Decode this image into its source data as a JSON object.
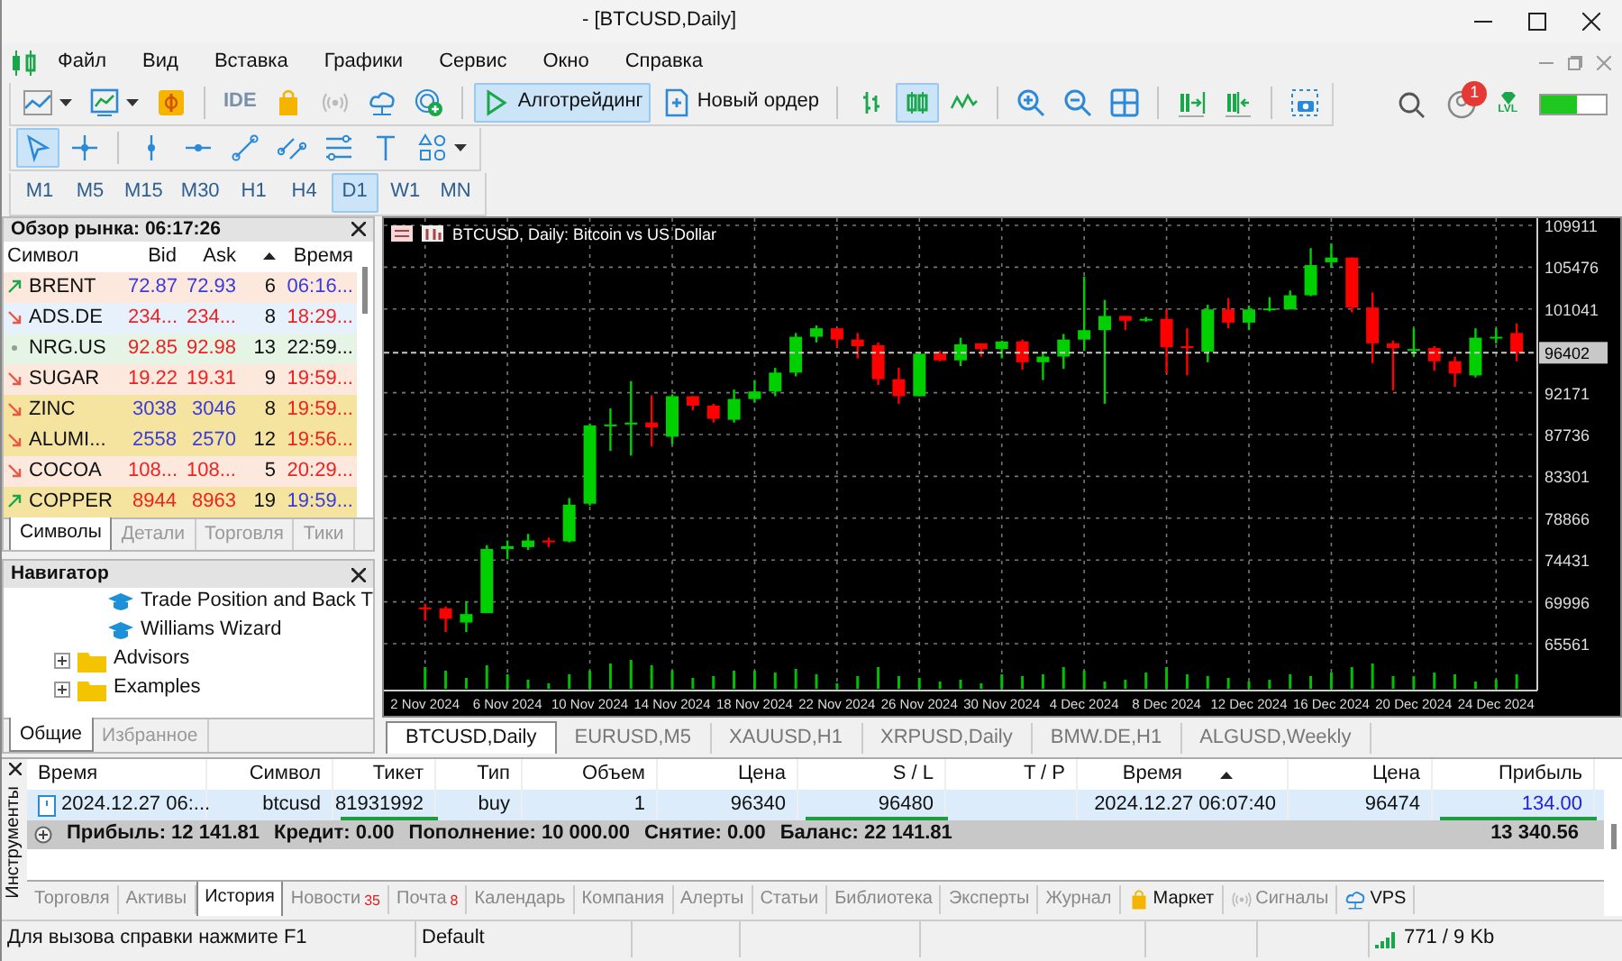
{
  "window": {
    "title": "- [BTCUSD,Daily]"
  },
  "menu": [
    "Файл",
    "Вид",
    "Вставка",
    "Графики",
    "Сервис",
    "Окно",
    "Справка"
  ],
  "toolbar": {
    "ide": "IDE",
    "algo_trading": {
      "label": "Алготрейдинг",
      "selected": true
    },
    "new_order": {
      "label": "Новый ордер",
      "selected": false
    },
    "chart_types": [
      {
        "selected": false
      },
      {
        "selected": true
      },
      {
        "selected": false
      }
    ],
    "notification_count": "1",
    "level_badge": "LVL",
    "meter": {
      "level": 0.55
    }
  },
  "drawing_tools": [
    {
      "selected": true
    },
    {
      "selected": false
    },
    {
      "selected": false
    },
    {
      "selected": false
    },
    {
      "selected": false
    },
    {
      "selected": false
    },
    {
      "selected": false
    },
    {
      "selected": false
    },
    {
      "selected": false
    }
  ],
  "timeframes": [
    {
      "label": "M1",
      "selected": false
    },
    {
      "label": "M5",
      "selected": false
    },
    {
      "label": "M15",
      "selected": false
    },
    {
      "label": "M30",
      "selected": false
    },
    {
      "label": "H1",
      "selected": false
    },
    {
      "label": "H4",
      "selected": false
    },
    {
      "label": "D1",
      "selected": true
    },
    {
      "label": "W1",
      "selected": false
    },
    {
      "label": "MN",
      "selected": false
    }
  ],
  "market_watch": {
    "title": "Обзор рынка: 06:17:26",
    "columns": [
      {
        "label": "Символ",
        "sorted": false
      },
      {
        "label": "Bid",
        "sorted": false
      },
      {
        "label": "Ask",
        "sorted": false
      },
      {
        "sorted": true
      },
      {
        "label": "Время",
        "sorted": false
      }
    ],
    "rows": [
      {
        "kind": "up",
        "symbol": "BRENT",
        "bid": {
          "text": "72.87",
          "color": "#3b3bdc"
        },
        "ask": {
          "text": "72.93",
          "color": "#3b3bdc"
        },
        "spread": "6",
        "time": {
          "text": "06:16...",
          "color": "#3b3bdc"
        },
        "color": "#fce8dc"
      },
      {
        "kind": "down",
        "symbol": "ADS.DE",
        "bid": {
          "text": "234...",
          "color": "#ee2222"
        },
        "ask": {
          "text": "234...",
          "color": "#ee2222"
        },
        "spread": "8",
        "time": {
          "text": "18:29...",
          "color": "#ee2222"
        },
        "color": "#e6f1fb"
      },
      {
        "kind": "flat",
        "symbol": "NRG.US",
        "bid": {
          "text": "92.85",
          "color": "#ee2222"
        },
        "ask": {
          "text": "92.98",
          "color": "#ee2222"
        },
        "spread": "13",
        "time": {
          "text": "22:59...",
          "color": "#111111"
        },
        "color": "#e6f4e6"
      },
      {
        "kind": "down",
        "symbol": "SUGAR",
        "bid": {
          "text": "19.22",
          "color": "#ee2222"
        },
        "ask": {
          "text": "19.31",
          "color": "#ee2222"
        },
        "spread": "9",
        "time": {
          "text": "19:59...",
          "color": "#ee2222"
        },
        "color": "#fce8dc"
      },
      {
        "kind": "down",
        "symbol": "ZINC",
        "bid": {
          "text": "3038",
          "color": "#3b3bdc"
        },
        "ask": {
          "text": "3046",
          "color": "#3b3bdc"
        },
        "spread": "8",
        "time": {
          "text": "19:59...",
          "color": "#ee2222"
        },
        "color": "#f5e4a0"
      },
      {
        "kind": "down",
        "symbol": "ALUMI...",
        "bid": {
          "text": "2558",
          "color": "#3b3bdc"
        },
        "ask": {
          "text": "2570",
          "color": "#3b3bdc"
        },
        "spread": "12",
        "time": {
          "text": "19:56...",
          "color": "#ee2222"
        },
        "color": "#f5e4a0"
      },
      {
        "kind": "down",
        "symbol": "COCOA",
        "bid": {
          "text": "108...",
          "color": "#ee2222"
        },
        "ask": {
          "text": "108...",
          "color": "#ee2222"
        },
        "spread": "5",
        "time": {
          "text": "20:29...",
          "color": "#ee2222"
        },
        "color": "#fce8dc"
      },
      {
        "kind": "up",
        "symbol": "COPPER",
        "bid": {
          "text": "8944",
          "color": "#ee2222"
        },
        "ask": {
          "text": "8963",
          "color": "#ee2222"
        },
        "spread": "19",
        "time": {
          "text": "19:59...",
          "color": "#3b3bdc"
        },
        "color": "#f5e4a0"
      }
    ],
    "tabs": [
      {
        "label": "Символы",
        "selected": true
      },
      {
        "label": "Детали",
        "selected": false
      },
      {
        "label": "Торговля",
        "selected": false
      },
      {
        "label": "Тики",
        "selected": false
      }
    ]
  },
  "navigator": {
    "title": "Навигатор",
    "tree": [
      {
        "children": [
          {
            "label": "Trade Position and Back T",
            "kind": "wizard"
          },
          {
            "label": "Williams Wizard",
            "kind": "wizard"
          }
        ]
      },
      {
        "label": "Advisors",
        "kind": "folder",
        "expanded": false
      },
      {
        "label": "Examples",
        "kind": "folder",
        "expanded": false
      }
    ],
    "tabs": [
      {
        "label": "Общие",
        "selected": true
      },
      {
        "label": "Избранное",
        "selected": false
      }
    ]
  },
  "chart": {
    "title": "BTCUSD, Daily:  Bitcoin vs US Dollar",
    "chart_data": {
      "type": "candlestick",
      "x": [
        "2024-11-02",
        "2024-11-03",
        "2024-11-04",
        "2024-11-05",
        "2024-11-06",
        "2024-11-07",
        "2024-11-08",
        "2024-11-09",
        "2024-11-10",
        "2024-11-11",
        "2024-11-12",
        "2024-11-13",
        "2024-11-14",
        "2024-11-15",
        "2024-11-16",
        "2024-11-17",
        "2024-11-18",
        "2024-11-19",
        "2024-11-20",
        "2024-11-21",
        "2024-11-22",
        "2024-11-23",
        "2024-11-24",
        "2024-11-25",
        "2024-11-26",
        "2024-11-27",
        "2024-11-28",
        "2024-11-29",
        "2024-11-30",
        "2024-12-01",
        "2024-12-02",
        "2024-12-03",
        "2024-12-04",
        "2024-12-05",
        "2024-12-06",
        "2024-12-07",
        "2024-12-08",
        "2024-12-09",
        "2024-12-10",
        "2024-12-11",
        "2024-12-12",
        "2024-12-13",
        "2024-12-14",
        "2024-12-15",
        "2024-12-16",
        "2024-12-17",
        "2024-12-18",
        "2024-12-19",
        "2024-12-20",
        "2024-12-21",
        "2024-12-22",
        "2024-12-23",
        "2024-12-24",
        "2024-12-25"
      ],
      "ohlc": [
        [
          69400,
          69800,
          68000,
          69300
        ],
        [
          69300,
          69500,
          66800,
          68200
        ],
        [
          67800,
          70000,
          66800,
          68700
        ],
        [
          68800,
          76000,
          68800,
          75600
        ],
        [
          75600,
          76500,
          74500,
          75900
        ],
        [
          75800,
          77200,
          75500,
          76500
        ],
        [
          76500,
          76800,
          75800,
          76300
        ],
        [
          76400,
          81000,
          76300,
          80300
        ],
        [
          80400,
          88900,
          80200,
          88700
        ],
        [
          88700,
          90500,
          86000,
          88800
        ],
        [
          88800,
          93400,
          85500,
          89000
        ],
        [
          89000,
          91900,
          86500,
          88500
        ],
        [
          87500,
          92000,
          86700,
          91800
        ],
        [
          91800,
          91800,
          90300,
          90800
        ],
        [
          90800,
          91000,
          89000,
          89400
        ],
        [
          89300,
          92500,
          89000,
          91500
        ],
        [
          91500,
          93500,
          91100,
          92300
        ],
        [
          92300,
          94800,
          91800,
          94300
        ],
        [
          94300,
          98500,
          93900,
          98100
        ],
        [
          98100,
          99300,
          97500,
          99000
        ],
        [
          99000,
          99000,
          97000,
          97800
        ],
        [
          97800,
          98500,
          95800,
          97100
        ],
        [
          97200,
          97500,
          93000,
          93600
        ],
        [
          93600,
          94800,
          91000,
          91800
        ],
        [
          91800,
          96500,
          91800,
          96300
        ],
        [
          96300,
          96600,
          95500,
          95600
        ],
        [
          95600,
          98000,
          95000,
          97300
        ],
        [
          97400,
          97400,
          96000,
          96800
        ],
        [
          96800,
          97700,
          95800,
          97600
        ],
        [
          97600,
          97800,
          94600,
          95400
        ],
        [
          95400,
          96500,
          93500,
          96000
        ],
        [
          96000,
          98400,
          94700,
          97800
        ],
        [
          97800,
          104500,
          96600,
          98800
        ],
        [
          98800,
          102000,
          91000,
          100300
        ],
        [
          100300,
          100300,
          98800,
          99800
        ],
        [
          99900,
          100200,
          99700,
          100000
        ],
        [
          100000,
          101000,
          94200,
          97000
        ],
        [
          97100,
          99000,
          94000,
          96900
        ],
        [
          96500,
          101500,
          95400,
          101000
        ],
        [
          101000,
          102200,
          99000,
          99600
        ],
        [
          99600,
          101400,
          98800,
          101000
        ],
        [
          101000,
          102300,
          100800,
          101100
        ],
        [
          101000,
          103000,
          101000,
          102500
        ],
        [
          102500,
          107500,
          102400,
          105700
        ],
        [
          106000,
          108000,
          105500,
          106500
        ],
        [
          106500,
          106500,
          100700,
          101200
        ],
        [
          101200,
          102800,
          95300,
          97400
        ],
        [
          97400,
          97700,
          92400,
          96900
        ],
        [
          96600,
          99000,
          96000,
          96800
        ],
        [
          96900,
          97100,
          94500,
          95500
        ],
        [
          95500,
          96000,
          92800,
          94200
        ],
        [
          94000,
          99000,
          93800,
          98000
        ],
        [
          98000,
          99000,
          97400,
          98100
        ],
        [
          98500,
          99500,
          95500,
          96400
        ]
      ],
      "xlim": [
        "2024-10-31",
        "2024-12-26"
      ],
      "ylim": [
        60590,
        110675
      ],
      "grid": true,
      "yticks": [
        {
          "value": 109911,
          "label": "109911"
        },
        {
          "value": 105476,
          "label": "105476"
        },
        {
          "value": 101041,
          "label": "101041"
        },
        {
          "value": 92171,
          "label": "92171"
        },
        {
          "value": 87736,
          "label": "87736"
        },
        {
          "value": 83301,
          "label": "83301"
        },
        {
          "value": 78866,
          "label": "78866"
        },
        {
          "value": 74431,
          "label": "74431"
        },
        {
          "value": 69996,
          "label": "69996"
        },
        {
          "value": 65561,
          "label": "65561"
        }
      ],
      "xticks": [
        {
          "value": "2024-11-02",
          "label": "2 Nov 2024"
        },
        {
          "value": "2024-11-06",
          "label": "6 Nov 2024"
        },
        {
          "value": "2024-11-10",
          "label": "10 Nov 2024"
        },
        {
          "value": "2024-11-14",
          "label": "14 Nov 2024"
        },
        {
          "value": "2024-11-18",
          "label": "18 Nov 2024"
        },
        {
          "value": "2024-11-22",
          "label": "22 Nov 2024"
        },
        {
          "value": "2024-11-26",
          "label": "26 Nov 2024"
        },
        {
          "value": "2024-11-30",
          "label": "30 Nov 2024"
        },
        {
          "value": "2024-12-04",
          "label": "4 Dec 2024"
        },
        {
          "value": "2024-12-08",
          "label": "8 Dec 2024"
        },
        {
          "value": "2024-12-12",
          "label": "12 Dec 2024"
        },
        {
          "value": "2024-12-16",
          "label": "16 Dec 2024"
        },
        {
          "value": "2024-12-20",
          "label": "20 Dec 2024"
        },
        {
          "value": "2024-12-24",
          "label": "24 Dec 2024"
        }
      ],
      "ref_lines": [
        {
          "axis": "y",
          "value": 96402,
          "label": "96402"
        }
      ]
    },
    "tabs": [
      {
        "label": "BTCUSD,Daily",
        "selected": true
      },
      {
        "label": "EURUSD,M5",
        "selected": false
      },
      {
        "label": "XAUUSD,H1",
        "selected": false
      },
      {
        "label": "XRPUSD,Daily",
        "selected": false
      },
      {
        "label": "BMW.DE,H1",
        "selected": false
      },
      {
        "label": "ALGUSD,Weekly",
        "selected": false
      }
    ]
  },
  "terminal": {
    "side_label": "Инструменты",
    "columns": [
      {
        "label": "Время",
        "sorted": false
      },
      {
        "label": "Символ",
        "sorted": false
      },
      {
        "label": "Тикет",
        "sorted": false
      },
      {
        "label": "Тип",
        "sorted": false
      },
      {
        "label": "Объем",
        "sorted": false
      },
      {
        "label": "Цена",
        "sorted": false
      },
      {
        "label": "S / L",
        "sorted": false
      },
      {
        "label": "T / P",
        "sorted": false
      },
      {
        "label": "Время",
        "sorted": true
      },
      {
        "label": "Цена",
        "sorted": false
      },
      {
        "label": "Прибыль",
        "sorted": false
      }
    ],
    "rows": [
      {
        "selected": true,
        "cells": [
          {
            "text": "2024.12.27 06:...",
            "underlined": false
          },
          {
            "text": "btcusd",
            "underlined": false
          },
          {
            "text": "81931992",
            "underlined": true
          },
          {
            "text": "buy",
            "underlined": false
          },
          {
            "text": "1",
            "underlined": false
          },
          {
            "text": "96340",
            "underlined": false
          },
          {
            "text": "96480",
            "underlined": true
          },
          {
            "underlined": false
          },
          {
            "text": "2024.12.27 06:07:40",
            "underlined": false
          },
          {
            "text": "96474",
            "underlined": false
          },
          {
            "text": "134.00",
            "underlined": true,
            "kind": "profit"
          }
        ]
      }
    ],
    "summary": [
      "Прибыль: 12 141.81",
      "Кредит: 0.00",
      "Пополнение: 10 000.00",
      "Снятие: 0.00",
      "Баланс: 22 141.81"
    ],
    "total": "13 340.56",
    "tabs": [
      {
        "label": "Торговля",
        "selected": false,
        "kind": "plain"
      },
      {
        "label": "Активы",
        "selected": false,
        "kind": "plain"
      },
      {
        "label": "История",
        "selected": true,
        "kind": "plain"
      },
      {
        "label": "Новости",
        "badge": "35",
        "selected": false,
        "kind": "plain"
      },
      {
        "label": "Почта",
        "badge": "8",
        "selected": false,
        "kind": "plain"
      },
      {
        "label": "Календарь",
        "selected": false,
        "kind": "plain"
      },
      {
        "label": "Компания",
        "selected": false,
        "kind": "plain"
      },
      {
        "label": "Алерты",
        "selected": false,
        "kind": "plain"
      },
      {
        "label": "Статьи",
        "selected": false,
        "kind": "plain"
      },
      {
        "label": "Библиотека",
        "selected": false,
        "kind": "plain"
      },
      {
        "label": "Эксперты",
        "selected": false,
        "kind": "plain"
      },
      {
        "label": "Журнал",
        "selected": false,
        "kind": "plain"
      },
      {
        "label": "Маркет",
        "selected": false,
        "kind": "market"
      },
      {
        "label": "Сигналы",
        "selected": false,
        "kind": "signals"
      },
      {
        "label": "VPS",
        "selected": false,
        "kind": "vps"
      }
    ]
  },
  "status_bar": {
    "help": "Для вызова справки нажмите F1",
    "profile": "Default",
    "traffic": "771 / 9 Kb"
  }
}
